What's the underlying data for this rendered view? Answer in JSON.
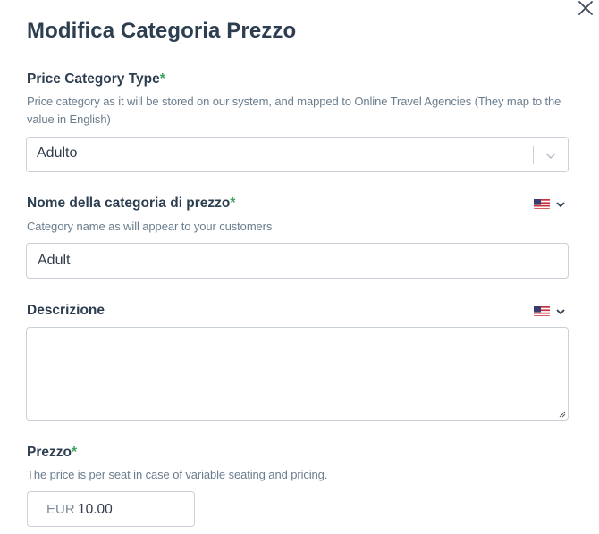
{
  "modal": {
    "title": "Modifica Categoria Prezzo",
    "close_icon": "close-icon"
  },
  "price_category_type": {
    "label": "Price Category Type",
    "required_mark": "*",
    "help": "Price category as it will be stored on our system, and mapped to Online Travel Agencies (They map to the value in English)",
    "selected_value": "Adulto",
    "dropdown_icon": "chevron-down-icon"
  },
  "category_name": {
    "label": "Nome della categoria di prezzo",
    "required_mark": "*",
    "help": "Category name as will appear to your customers",
    "value": "Adult",
    "language_icon": "us-flag-icon"
  },
  "description": {
    "label": "Descrizione",
    "value": "",
    "language_icon": "us-flag-icon"
  },
  "price": {
    "label": "Prezzo",
    "required_mark": "*",
    "help": "The price is per seat in case of variable seating and pricing.",
    "currency": "EUR",
    "value": "10.00"
  },
  "colors": {
    "required_accent": "#3aa55c",
    "heading": "#2d3e50",
    "help_text": "#6a7d8e",
    "border": "#c9d0d8"
  }
}
